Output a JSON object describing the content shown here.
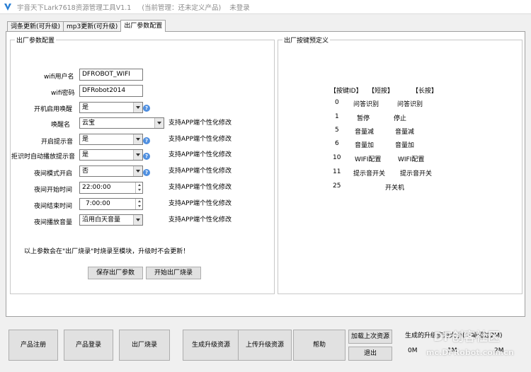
{
  "titlebar": {
    "app_title": "宇音天下Lark7618资源管理工具V1.1",
    "manage_status": "(当前管理：还未定义产品)",
    "login_status": "未登录"
  },
  "tabs": [
    {
      "label": "词条更新(可升级)"
    },
    {
      "label": "mp3更新(可升级)"
    },
    {
      "label": "出厂参数配置"
    }
  ],
  "factory_params": {
    "legend": "出厂参数配置",
    "wifi_user_label": "wifi用户名",
    "wifi_user_value": "DFROBOT_WIFI",
    "wifi_pass_label": "wifi密码",
    "wifi_pass_value": "DFRobot2014",
    "wake_label": "开机启用唤醒",
    "wake_value": "是",
    "wake_name_label": "唤醒名",
    "wake_name_value": "云宝",
    "prompt_label": "开启提示音",
    "prompt_value": "是",
    "reject_label": "拒识时自动播放提示音（限版）",
    "reject_value": "是",
    "night_label": "夜间模式开启",
    "night_value": "否",
    "night_start_label": "夜间开始时间",
    "night_start_value": "22:00:00",
    "night_end_label": "夜间结束时间",
    "night_end_value": "7:00:00",
    "night_vol_label": "夜间播放音量",
    "night_vol_value": "沿用白天音量",
    "app_note": "支持APP端个性化修改",
    "footer_note": "以上参数会在\"出厂烧录\"时烧录至模块，升级时不会更新！",
    "save_button": "保存出厂参数",
    "burn_button": "开始出厂烧录"
  },
  "keys": {
    "legend": "出厂按键预定义",
    "header_id": "【按键ID】",
    "header_short": "【短按】",
    "header_long": "【长按】",
    "rows": [
      {
        "id": "0",
        "short": "问答识别",
        "long": "问答识别"
      },
      {
        "id": "1",
        "short": "暂停",
        "long": "停止"
      },
      {
        "id": "5",
        "short": "音量减",
        "long": "音量减"
      },
      {
        "id": "6",
        "short": "音量加",
        "long": "音量加"
      },
      {
        "id": "10",
        "short": "WIFI配置",
        "long": "WIFI配置"
      },
      {
        "id": "11",
        "short": "提示音开关",
        "long": "提示音开关"
      },
      {
        "id": "25",
        "short": "",
        "long": "开关机"
      }
    ]
  },
  "bottom": {
    "register": "产品注册",
    "login": "产品登录",
    "factory_burn": "出厂烧录",
    "gen_upgrade": "生成升级资源",
    "upload_upgrade": "上传升级资源",
    "help": "帮助",
    "load_last": "加载上次资源",
    "exit": "退出",
    "size_label": "生成的升级资源大小(不能超过2M)",
    "size_0": "0M",
    "size_1": "1M",
    "size_2": "2M"
  },
  "watermark": {
    "line1": "DF创客社区",
    "line2": "mc.DFRobot.com.cn"
  },
  "colors": {
    "window_bg": "#f0f0f0",
    "panel_bg": "#ffffff",
    "help_icon": "#4f8fe0",
    "title_text": "#8a8a8a"
  }
}
